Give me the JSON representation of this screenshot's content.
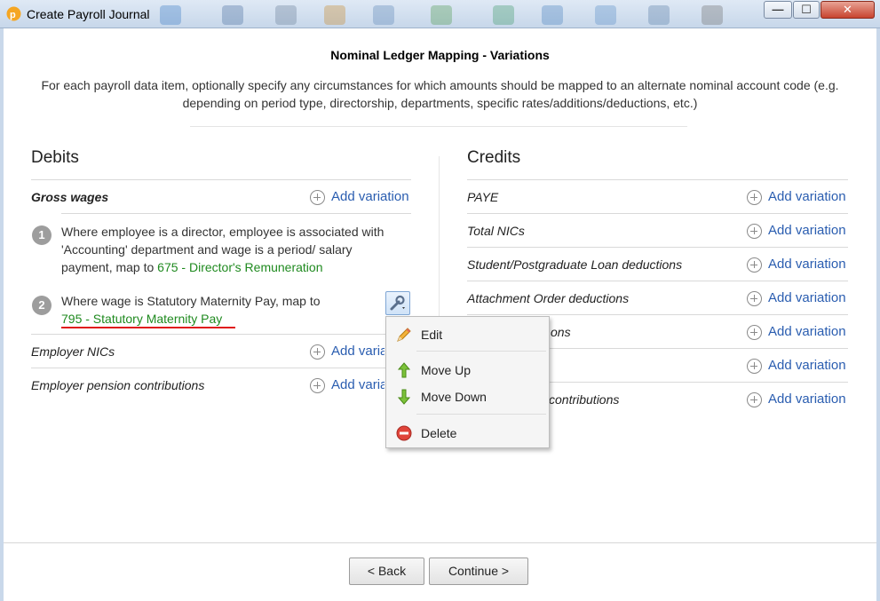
{
  "window": {
    "title": "Create Payroll Journal",
    "minimize_glyph": "—",
    "maximize_glyph": "☐",
    "close_glyph": "✕"
  },
  "header": {
    "title": "Nominal Ledger Mapping - Variations",
    "description": "For each payroll data item, optionally specify any circumstances for which amounts should be mapped to an alternate nominal account code (e.g. depending on period type, directorship, departments, specific rates/additions/deductions, etc.)"
  },
  "debits": {
    "title": "Debits",
    "add_label": "Add variation",
    "gross_wages": {
      "label": "Gross wages",
      "variations": [
        {
          "num": "1",
          "text": "Where employee is a director, employee is associated with 'Accounting' department and wage is a period/ salary payment, map to ",
          "code": "675 - Director's Remuneration"
        },
        {
          "num": "2",
          "text": "Where wage is Statutory Maternity Pay, map to",
          "code": "795 - Statutory Maternity Pay"
        }
      ]
    },
    "items": [
      {
        "label": "Employer NICs"
      },
      {
        "label": "Employer pension contributions"
      }
    ]
  },
  "credits": {
    "title": "Credits",
    "add_label": "Add variation",
    "items": [
      {
        "label": "PAYE"
      },
      {
        "label": "Total NICs"
      },
      {
        "label": "Student/Postgraduate Loan deductions"
      },
      {
        "label": "Attachment Order deductions"
      },
      {
        "label": "ons"
      },
      {
        "label": ""
      },
      {
        "label": "contributions"
      }
    ]
  },
  "context_menu": {
    "items": [
      {
        "label": "Edit",
        "icon": "pencil-icon"
      },
      {
        "label": "Move Up",
        "icon": "arrow-up-icon"
      },
      {
        "label": "Move Down",
        "icon": "arrow-down-icon"
      },
      {
        "label": "Delete",
        "icon": "delete-icon"
      }
    ]
  },
  "footer": {
    "back_label": "< Back",
    "continue_label": "Continue >"
  },
  "colors": {
    "link": "#2a5db0",
    "code": "#1f8a1f",
    "highlight": "#e01818"
  }
}
